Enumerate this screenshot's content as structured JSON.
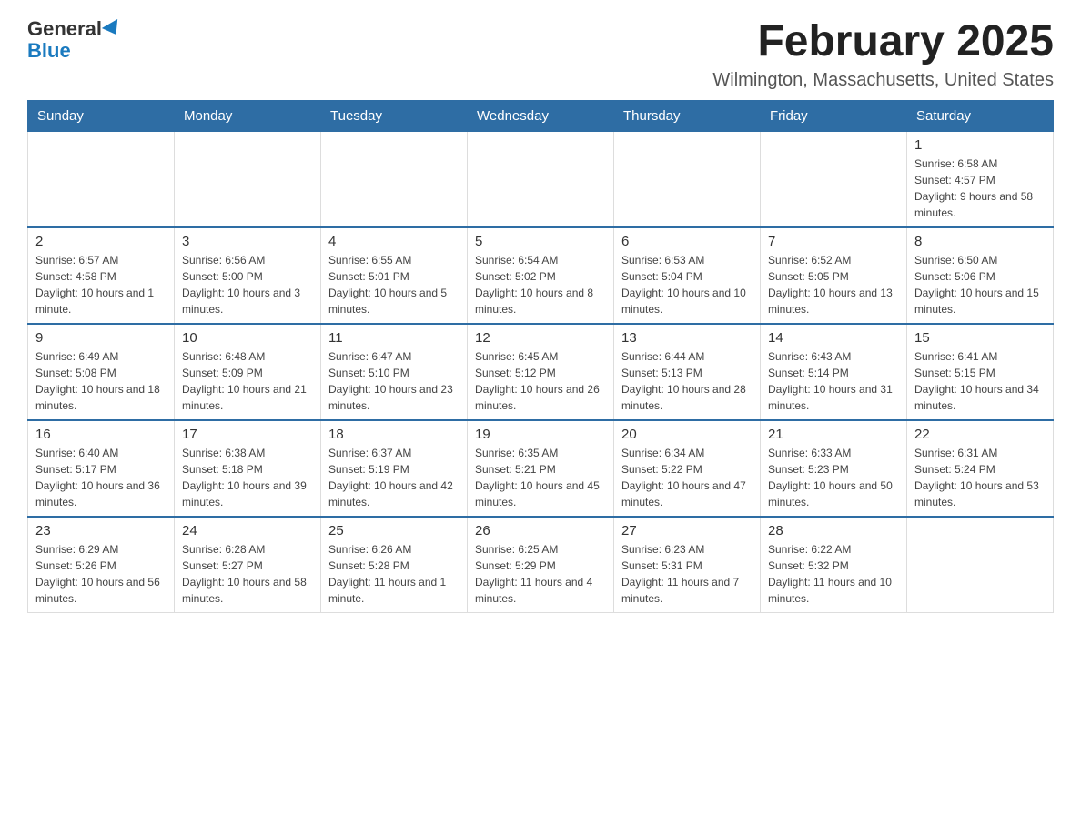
{
  "logo": {
    "general": "General",
    "blue": "Blue"
  },
  "header": {
    "title": "February 2025",
    "location": "Wilmington, Massachusetts, United States"
  },
  "days_of_week": [
    "Sunday",
    "Monday",
    "Tuesday",
    "Wednesday",
    "Thursday",
    "Friday",
    "Saturday"
  ],
  "weeks": [
    [
      {
        "day": "",
        "info": ""
      },
      {
        "day": "",
        "info": ""
      },
      {
        "day": "",
        "info": ""
      },
      {
        "day": "",
        "info": ""
      },
      {
        "day": "",
        "info": ""
      },
      {
        "day": "",
        "info": ""
      },
      {
        "day": "1",
        "info": "Sunrise: 6:58 AM\nSunset: 4:57 PM\nDaylight: 9 hours and 58 minutes."
      }
    ],
    [
      {
        "day": "2",
        "info": "Sunrise: 6:57 AM\nSunset: 4:58 PM\nDaylight: 10 hours and 1 minute."
      },
      {
        "day": "3",
        "info": "Sunrise: 6:56 AM\nSunset: 5:00 PM\nDaylight: 10 hours and 3 minutes."
      },
      {
        "day": "4",
        "info": "Sunrise: 6:55 AM\nSunset: 5:01 PM\nDaylight: 10 hours and 5 minutes."
      },
      {
        "day": "5",
        "info": "Sunrise: 6:54 AM\nSunset: 5:02 PM\nDaylight: 10 hours and 8 minutes."
      },
      {
        "day": "6",
        "info": "Sunrise: 6:53 AM\nSunset: 5:04 PM\nDaylight: 10 hours and 10 minutes."
      },
      {
        "day": "7",
        "info": "Sunrise: 6:52 AM\nSunset: 5:05 PM\nDaylight: 10 hours and 13 minutes."
      },
      {
        "day": "8",
        "info": "Sunrise: 6:50 AM\nSunset: 5:06 PM\nDaylight: 10 hours and 15 minutes."
      }
    ],
    [
      {
        "day": "9",
        "info": "Sunrise: 6:49 AM\nSunset: 5:08 PM\nDaylight: 10 hours and 18 minutes."
      },
      {
        "day": "10",
        "info": "Sunrise: 6:48 AM\nSunset: 5:09 PM\nDaylight: 10 hours and 21 minutes."
      },
      {
        "day": "11",
        "info": "Sunrise: 6:47 AM\nSunset: 5:10 PM\nDaylight: 10 hours and 23 minutes."
      },
      {
        "day": "12",
        "info": "Sunrise: 6:45 AM\nSunset: 5:12 PM\nDaylight: 10 hours and 26 minutes."
      },
      {
        "day": "13",
        "info": "Sunrise: 6:44 AM\nSunset: 5:13 PM\nDaylight: 10 hours and 28 minutes."
      },
      {
        "day": "14",
        "info": "Sunrise: 6:43 AM\nSunset: 5:14 PM\nDaylight: 10 hours and 31 minutes."
      },
      {
        "day": "15",
        "info": "Sunrise: 6:41 AM\nSunset: 5:15 PM\nDaylight: 10 hours and 34 minutes."
      }
    ],
    [
      {
        "day": "16",
        "info": "Sunrise: 6:40 AM\nSunset: 5:17 PM\nDaylight: 10 hours and 36 minutes."
      },
      {
        "day": "17",
        "info": "Sunrise: 6:38 AM\nSunset: 5:18 PM\nDaylight: 10 hours and 39 minutes."
      },
      {
        "day": "18",
        "info": "Sunrise: 6:37 AM\nSunset: 5:19 PM\nDaylight: 10 hours and 42 minutes."
      },
      {
        "day": "19",
        "info": "Sunrise: 6:35 AM\nSunset: 5:21 PM\nDaylight: 10 hours and 45 minutes."
      },
      {
        "day": "20",
        "info": "Sunrise: 6:34 AM\nSunset: 5:22 PM\nDaylight: 10 hours and 47 minutes."
      },
      {
        "day": "21",
        "info": "Sunrise: 6:33 AM\nSunset: 5:23 PM\nDaylight: 10 hours and 50 minutes."
      },
      {
        "day": "22",
        "info": "Sunrise: 6:31 AM\nSunset: 5:24 PM\nDaylight: 10 hours and 53 minutes."
      }
    ],
    [
      {
        "day": "23",
        "info": "Sunrise: 6:29 AM\nSunset: 5:26 PM\nDaylight: 10 hours and 56 minutes."
      },
      {
        "day": "24",
        "info": "Sunrise: 6:28 AM\nSunset: 5:27 PM\nDaylight: 10 hours and 58 minutes."
      },
      {
        "day": "25",
        "info": "Sunrise: 6:26 AM\nSunset: 5:28 PM\nDaylight: 11 hours and 1 minute."
      },
      {
        "day": "26",
        "info": "Sunrise: 6:25 AM\nSunset: 5:29 PM\nDaylight: 11 hours and 4 minutes."
      },
      {
        "day": "27",
        "info": "Sunrise: 6:23 AM\nSunset: 5:31 PM\nDaylight: 11 hours and 7 minutes."
      },
      {
        "day": "28",
        "info": "Sunrise: 6:22 AM\nSunset: 5:32 PM\nDaylight: 11 hours and 10 minutes."
      },
      {
        "day": "",
        "info": ""
      }
    ]
  ]
}
